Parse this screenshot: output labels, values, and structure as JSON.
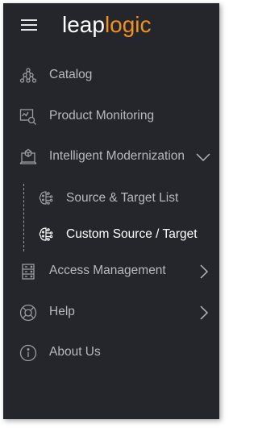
{
  "brand": {
    "logo_part1": "leap",
    "logo_part2": "logic"
  },
  "colors": {
    "sidebar_bg": "#25262b",
    "text": "#b9b9bd",
    "active_text": "#ffffff",
    "brand_orange": "#f0901e"
  },
  "nav": {
    "catalog": {
      "label": "Catalog",
      "icon": "catalog-tree-icon"
    },
    "product_monitoring": {
      "label": "Product Monitoring",
      "icon": "monitor-search-icon"
    },
    "intelligent_modernization": {
      "label": "Intelligent Modernization",
      "icon": "laptop-modernize-icon",
      "expanded": true,
      "children": [
        {
          "label": "Source & Target List",
          "icon": "brain-circuit-icon",
          "active": false
        },
        {
          "label": "Custom Source / Target",
          "icon": "brain-circuit-icon",
          "active": true
        }
      ]
    },
    "access_management": {
      "label": "Access Management",
      "icon": "server-rack-icon"
    },
    "help": {
      "label": "Help",
      "icon": "lifebuoy-icon"
    },
    "about_us": {
      "label": "About Us",
      "icon": "info-circle-icon"
    }
  }
}
